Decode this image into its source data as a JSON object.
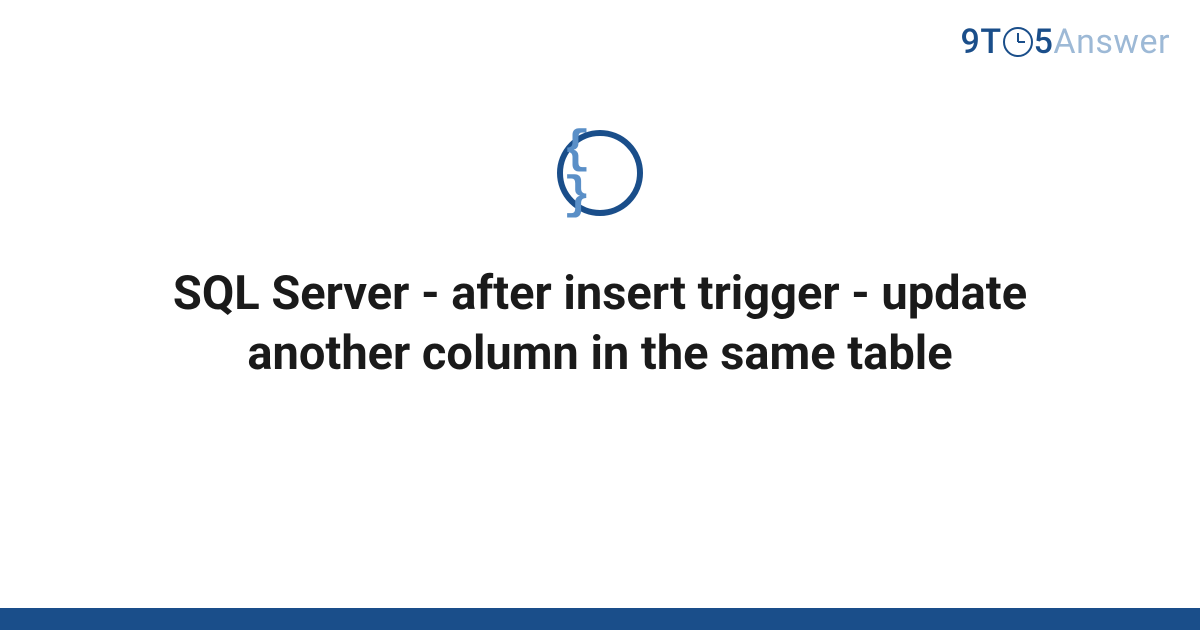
{
  "logo": {
    "prefix": "9T",
    "suffix": "5",
    "answer": "Answer"
  },
  "icon": {
    "braces": "{ }"
  },
  "title": "SQL Server - after insert trigger - update another column in the same table"
}
